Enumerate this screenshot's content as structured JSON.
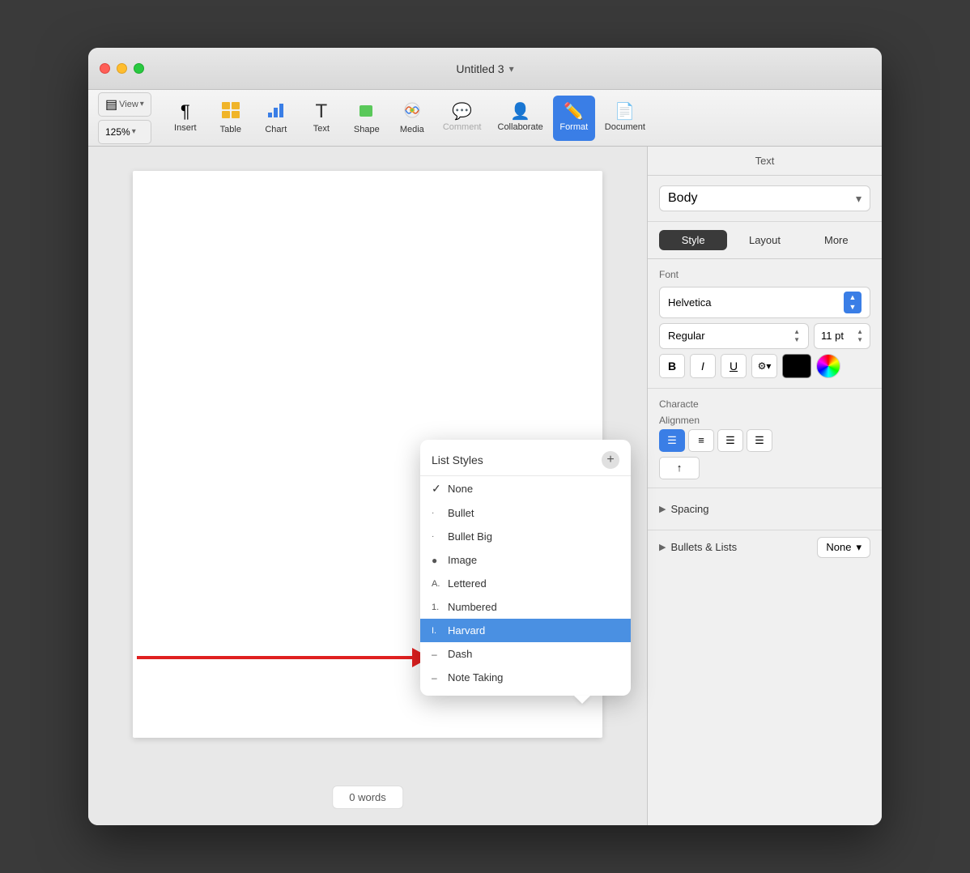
{
  "window": {
    "title": "Untitled 3",
    "title_dropdown": "▾"
  },
  "toolbar": {
    "view_label": "View",
    "zoom_value": "125%",
    "insert_label": "Insert",
    "table_label": "Table",
    "chart_label": "Chart",
    "text_label": "Text",
    "shape_label": "Shape",
    "media_label": "Media",
    "comment_label": "Comment",
    "collaborate_label": "Collaborate",
    "format_label": "Format",
    "document_label": "Document"
  },
  "right_panel": {
    "header": "Text",
    "style_dropdown_value": "Body",
    "tabs": [
      {
        "label": "Style",
        "active": true
      },
      {
        "label": "Layout",
        "active": false
      },
      {
        "label": "More",
        "active": false
      }
    ],
    "font_section_label": "Font",
    "font_name": "Helvetica",
    "font_style": "Regular",
    "font_size": "11 pt",
    "bold_label": "B",
    "italic_label": "I",
    "underline_label": "U",
    "character_label": "Characte",
    "alignment_label": "Alignmen",
    "spacing_label": "Spacing",
    "bullets_label": "Bullets & Lists",
    "bullets_value": "None"
  },
  "list_styles_popup": {
    "title": "List Styles",
    "add_btn": "+",
    "items": [
      {
        "label": "None",
        "prefix": "✓",
        "prefix_type": "check"
      },
      {
        "label": "Bullet",
        "prefix": "·",
        "prefix_type": "dot"
      },
      {
        "label": "Bullet Big",
        "prefix": "·",
        "prefix_type": "dot"
      },
      {
        "label": "Image",
        "prefix": "●",
        "prefix_type": "filled"
      },
      {
        "label": "Lettered",
        "prefix": "A.",
        "prefix_type": "text"
      },
      {
        "label": "Numbered",
        "prefix": "1.",
        "prefix_type": "text"
      },
      {
        "label": "Harvard",
        "prefix": "I.",
        "prefix_type": "text"
      },
      {
        "label": "Dash",
        "prefix": "–",
        "prefix_type": "text"
      },
      {
        "label": "Note Taking",
        "prefix": "–",
        "prefix_type": "text"
      }
    ]
  },
  "word_count": "0 words"
}
